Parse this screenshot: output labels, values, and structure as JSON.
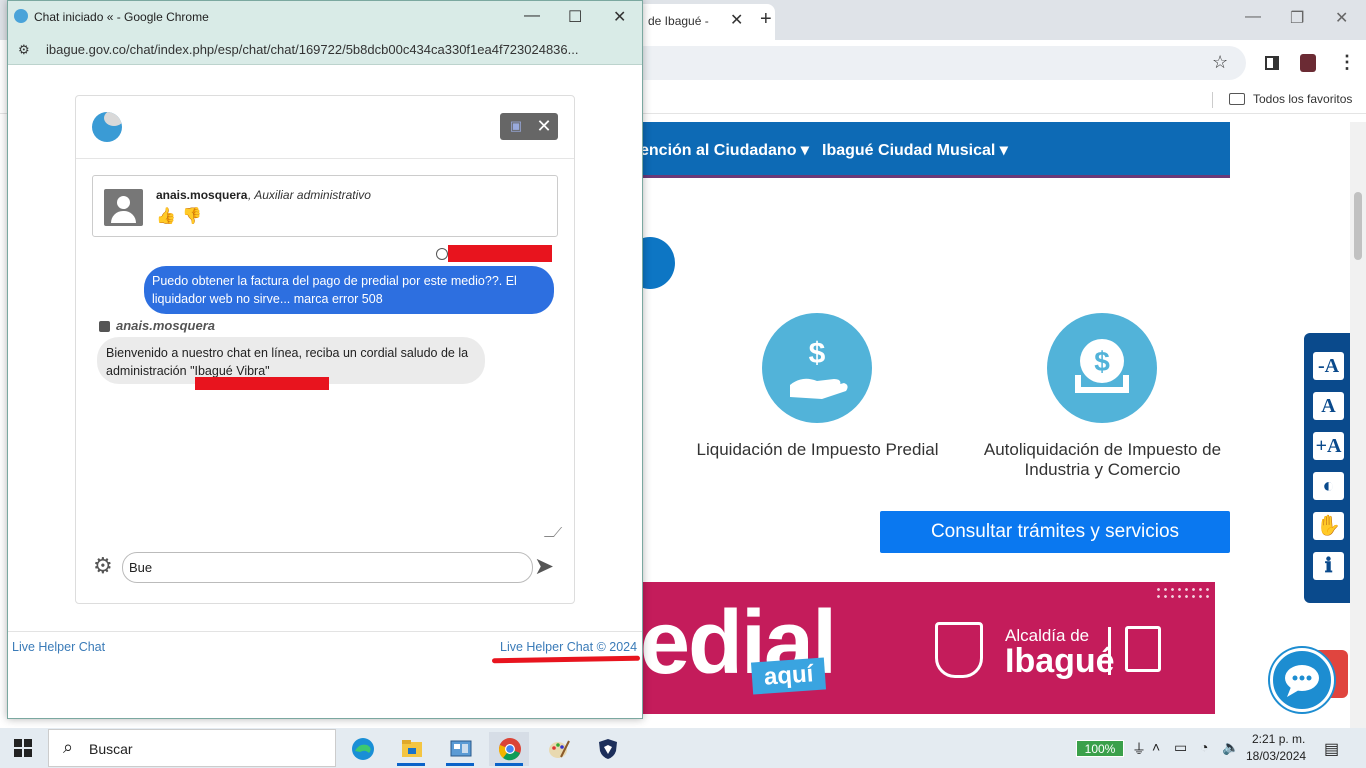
{
  "background_browser": {
    "tab_title": "de Ibagué - ",
    "new_tab_label": "+",
    "minimize_label": "—",
    "maximize_label": "❐",
    "close_label": "✕",
    "bookmarks_folder_label": "Todos los favoritos"
  },
  "site": {
    "nav_items": [
      "ención al Ciudadano ▾",
      "Ibagué Ciudad Musical ▾"
    ],
    "services": [
      {
        "label": "Liquidación de Impuesto Predial",
        "icon": "hand-money-icon"
      },
      {
        "label": "Autoliquidación de Impuesto de Industria y Comercio",
        "icon": "coin-tray-icon"
      }
    ],
    "consult_button": "Consultar trámites y servicios",
    "banner": {
      "big_text": "edial",
      "aqui_label": "aquí",
      "alcaldia_label": "Alcaldía de",
      "ibague_label": "Ibagué"
    },
    "accessibility_buttons": [
      "-A",
      "A",
      "+A",
      "◐",
      "✋",
      "ℹ"
    ]
  },
  "popup": {
    "title": "Chat iniciado « - Google Chrome",
    "url": "ibague.gov.co/chat/index.php/esp/chat/chat/169722/5b8dcb00c434ca330f1ea4f723024836...",
    "chat": {
      "agent_name": "anais.mosquera",
      "agent_role": ", Auxiliar administrativo",
      "visitor_message": "Puedo obtener la factura del pago de predial por  este medio??. El liquidador web no sirve... marca error 508",
      "operator_label": "anais.mosquera",
      "operator_message": "Bienvenido a nuestro chat en línea, reciba un cordial saludo de la administración \"Ibagué Vibra\"",
      "input_value": "Bue"
    },
    "footer_left": "Live Helper Chat",
    "footer_right": "Live Helper Chat © 2024"
  },
  "taskbar": {
    "search_placeholder": "Buscar",
    "battery_label": "100%",
    "time": "2:21 p. m.",
    "date": "18/03/2024",
    "apps": [
      "edge-icon",
      "file-explorer-icon",
      "control-panel-icon",
      "chrome-icon",
      "paint-icon",
      "shield-app-icon"
    ]
  },
  "colors": {
    "nav_blue": "#0d6ab5",
    "service_circle": "#52b3d9",
    "consult_button": "#0a78f0",
    "banner_magenta": "#c41c5b",
    "visitor_bubble": "#2d6fe0",
    "redaction_red": "#e8141e",
    "popup_titlebar": "#d9ebe7"
  }
}
